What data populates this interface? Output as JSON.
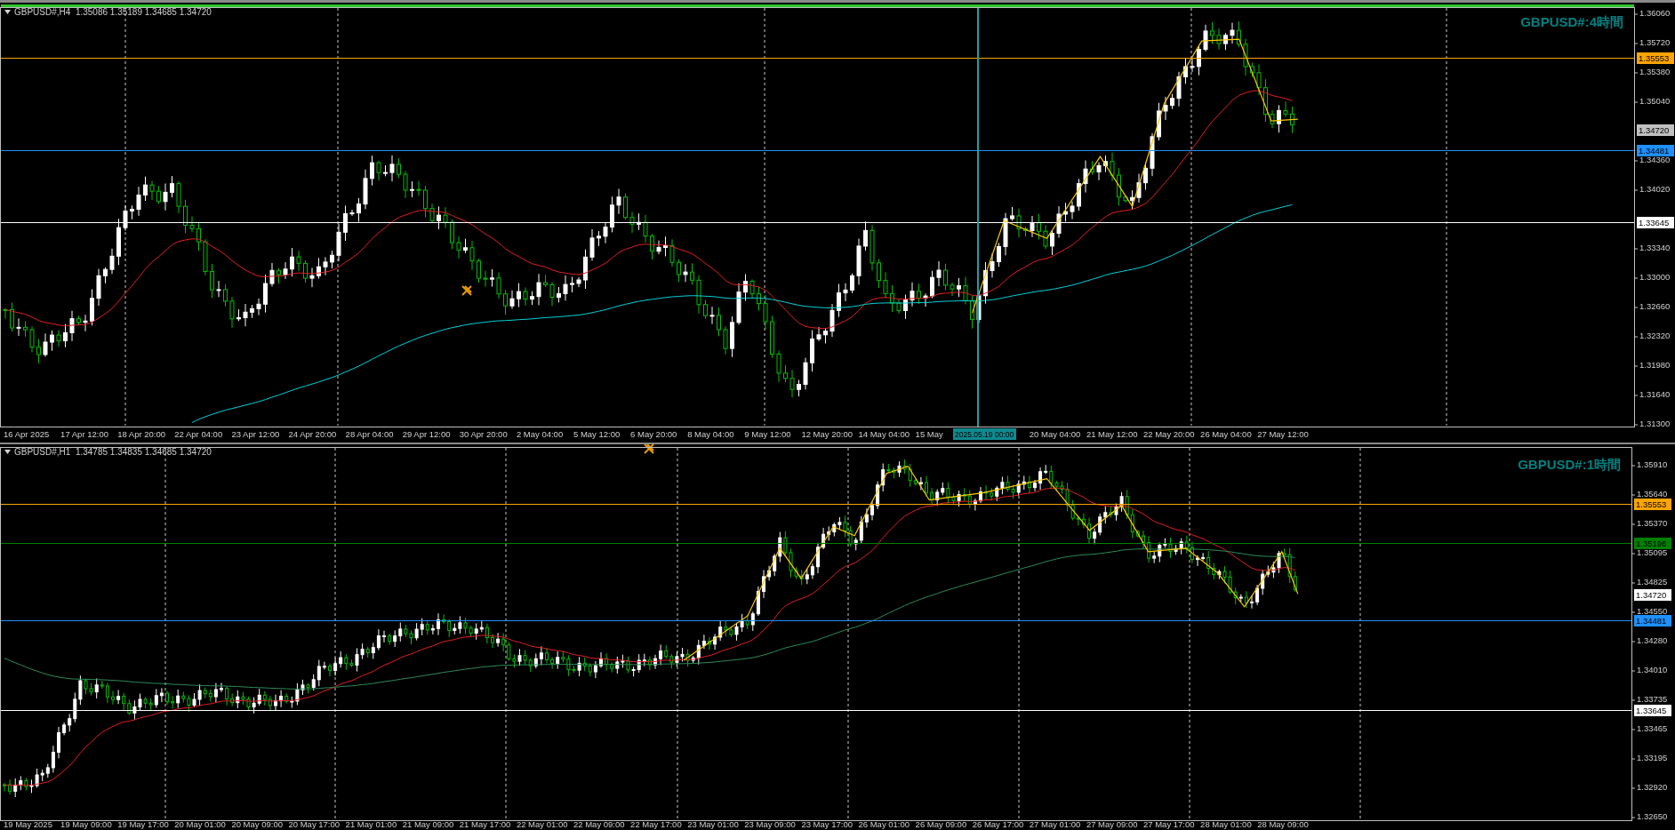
{
  "charts": [
    {
      "header": "GBPUSD#,H4  1.35086 1.35189 1.34685 1.34720",
      "title": "GBPUSD#:4時間",
      "price_axis": [
        "1.36060",
        "1.35720",
        "1.35380",
        "1.35040",
        "1.34360",
        "1.34020",
        "1.33340",
        "1.33000",
        "1.32660",
        "1.32320",
        "1.31980",
        "1.31640",
        "1.31300"
      ],
      "price_tags": [
        {
          "kind": "line",
          "text": "1.35553",
          "color": "#ffa500"
        },
        {
          "kind": "bid",
          "text": "1.34720",
          "color": "#c0c0c0"
        },
        {
          "kind": "line",
          "text": "1.34481",
          "color": "#1e90ff"
        },
        {
          "kind": "line",
          "text": "1.33645",
          "color": "#ffffff"
        }
      ],
      "time_axis": [
        {
          "kind": "tick",
          "text": "16 Apr 2025"
        },
        {
          "kind": "tick",
          "text": "17 Apr 12:00"
        },
        {
          "kind": "tick",
          "text": "18 Apr 20:00"
        },
        {
          "kind": "tick",
          "text": "22 Apr 04:00"
        },
        {
          "kind": "tick",
          "text": "23 Apr 12:00"
        },
        {
          "kind": "tick",
          "text": "24 Apr 20:00"
        },
        {
          "kind": "tick",
          "text": "28 Apr 04:00"
        },
        {
          "kind": "tick",
          "text": "29 Apr 12:00"
        },
        {
          "kind": "tick",
          "text": "30 Apr 20:00"
        },
        {
          "kind": "tick",
          "text": "2 May 04:00"
        },
        {
          "kind": "tick",
          "text": "5 May 12:00"
        },
        {
          "kind": "tick",
          "text": "6 May 20:00"
        },
        {
          "kind": "tick",
          "text": "8 May 04:00"
        },
        {
          "kind": "tick",
          "text": "9 May 12:00"
        },
        {
          "kind": "tick",
          "text": "12 May 20:00"
        },
        {
          "kind": "tick",
          "text": "14 May 04:00"
        },
        {
          "kind": "tick",
          "text": "15 May"
        },
        {
          "kind": "crosshair",
          "text": "2025.05.19 00:00"
        },
        {
          "kind": "tick",
          "text": "20 May 04:00"
        },
        {
          "kind": "tick",
          "text": "21 May 12:00"
        },
        {
          "kind": "tick",
          "text": "22 May 20:00"
        },
        {
          "kind": "tick",
          "text": "26 May 04:00"
        },
        {
          "kind": "tick",
          "text": "27 May 12:00"
        }
      ]
    },
    {
      "header": "GBPUSD#,H1  1.34785 1.34835 1.34685 1.34720",
      "title": "GBPUSD#:1時間",
      "price_axis": [
        "1.35910",
        "1.35640",
        "1.35370",
        "1.35095",
        "1.34825",
        "1.34550",
        "1.34280",
        "1.34010",
        "1.33735",
        "1.33465",
        "1.33195",
        "1.32920",
        "1.32650"
      ],
      "price_tags": [
        {
          "kind": "line",
          "text": "1.35553",
          "color": "#ffa500"
        },
        {
          "kind": "line",
          "text": "1.35196",
          "color": "#008000"
        },
        {
          "kind": "bid",
          "text": "1.34720",
          "color": "#ffffff"
        },
        {
          "kind": "line",
          "text": "1.34481",
          "color": "#1e90ff"
        },
        {
          "kind": "line",
          "text": "1.33645",
          "color": "#ffffff"
        }
      ],
      "time_axis": [
        {
          "kind": "tick",
          "text": "19 May 2025"
        },
        {
          "kind": "tick",
          "text": "19 May 09:00"
        },
        {
          "kind": "tick",
          "text": "19 May 17:00"
        },
        {
          "kind": "tick",
          "text": "20 May 01:00"
        },
        {
          "kind": "tick",
          "text": "20 May 09:00"
        },
        {
          "kind": "tick",
          "text": "20 May 17:00"
        },
        {
          "kind": "tick",
          "text": "21 May 01:00"
        },
        {
          "kind": "tick",
          "text": "21 May 09:00"
        },
        {
          "kind": "tick",
          "text": "21 May 17:00"
        },
        {
          "kind": "tick",
          "text": "22 May 01:00"
        },
        {
          "kind": "tick",
          "text": "22 May 09:00"
        },
        {
          "kind": "tick",
          "text": "22 May 17:00"
        },
        {
          "kind": "tick",
          "text": "23 May 01:00"
        },
        {
          "kind": "tick",
          "text": "23 May 09:00"
        },
        {
          "kind": "tick",
          "text": "23 May 17:00"
        },
        {
          "kind": "tick",
          "text": "26 May 01:00"
        },
        {
          "kind": "tick",
          "text": "26 May 09:00"
        },
        {
          "kind": "tick",
          "text": "26 May 17:00"
        },
        {
          "kind": "tick",
          "text": "27 May 01:00"
        },
        {
          "kind": "tick",
          "text": "27 May 09:00"
        },
        {
          "kind": "tick",
          "text": "27 May 17:00"
        },
        {
          "kind": "tick",
          "text": "28 May 01:00"
        },
        {
          "kind": "tick",
          "text": "28 May 09:00"
        }
      ]
    }
  ]
}
